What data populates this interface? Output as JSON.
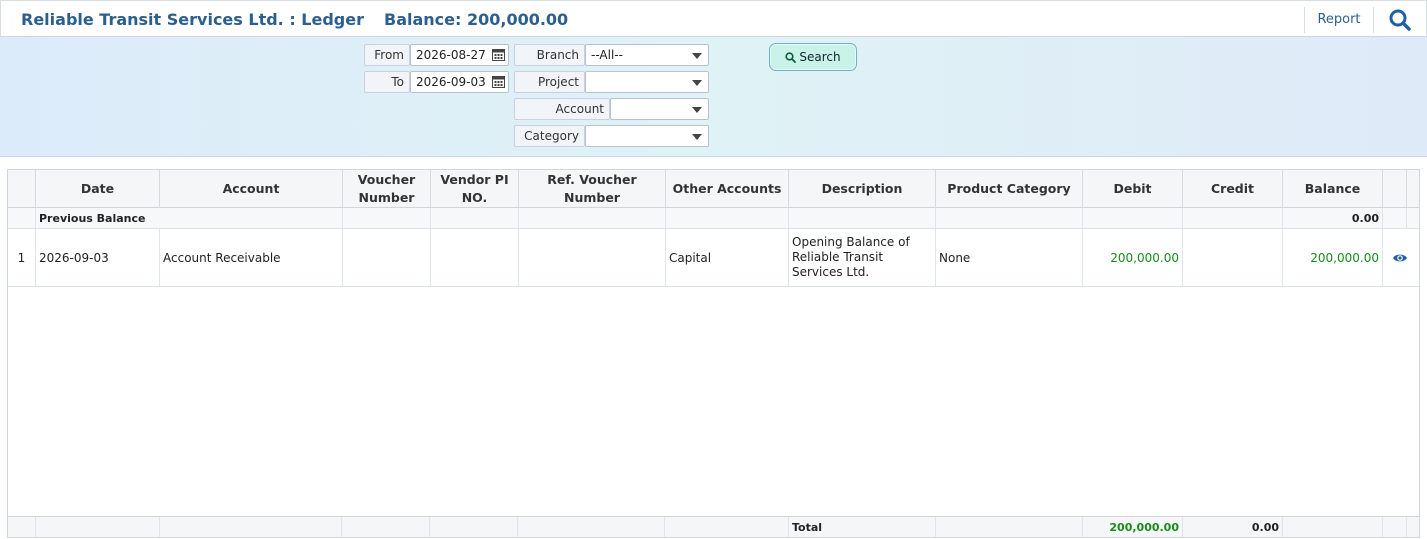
{
  "header": {
    "title": "Reliable Transit Services Ltd. : Ledger",
    "balance": "Balance: 200,000.00",
    "report_label": "Report"
  },
  "filters": {
    "from_label": "From",
    "from_value": "2026-08-27",
    "to_label": "To",
    "to_value": "2026-09-03",
    "branch_label": "Branch",
    "branch_value": "--All--",
    "project_label": "Project",
    "project_value": "",
    "account_label": "Account",
    "account_value": "",
    "category_label": "Category",
    "category_value": "",
    "search_label": "Search"
  },
  "table": {
    "columns": [
      "",
      "Date",
      "Account",
      "Voucher Number",
      "Vendor PI NO.",
      "Ref. Voucher Number",
      "Other Accounts",
      "Description",
      "Product Category",
      "Debit",
      "Credit",
      "Balance",
      ""
    ],
    "previous_balance": {
      "label": "Previous Balance",
      "balance": "0.00"
    },
    "rows": [
      {
        "index": "1",
        "date": "2026-09-03",
        "account": "Account Receivable",
        "voucher_number": "",
        "vendor_pi": "",
        "ref_voucher": "",
        "other_accounts": "Capital",
        "description": "Opening Balance of Reliable Transit Services Ltd.",
        "product_category": "None",
        "debit": "200,000.00",
        "credit": "",
        "balance": "200,000.00"
      }
    ],
    "footer": {
      "label": "Total",
      "debit": "200,000.00",
      "credit": "0.00"
    }
  },
  "colors": {
    "title": "#2d5f8e",
    "positive": "#1a8a1a",
    "accent": "#1f5fa8"
  },
  "icons": {
    "top_search": "search-icon",
    "calendar": "calendar-icon",
    "row_view": "eye-icon"
  }
}
